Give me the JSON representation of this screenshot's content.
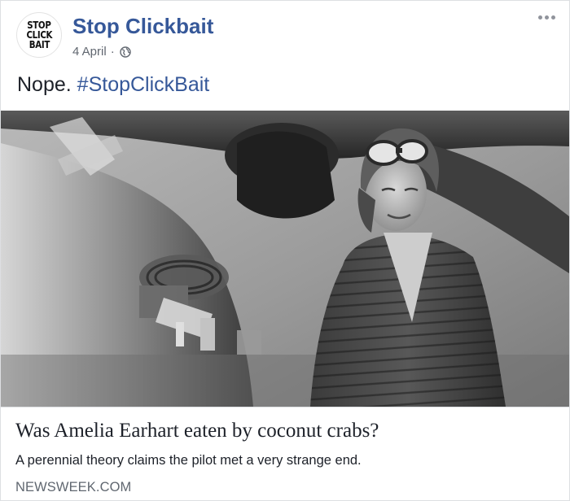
{
  "post": {
    "page_name": "Stop Clickbait",
    "avatar_lines": [
      "STOP",
      "CLICK",
      "BAIT"
    ],
    "date": "4 April",
    "separator": "·",
    "audience_icon": "globe-icon",
    "menu_icon": "more-options-icon",
    "text_prefix": "Nope. ",
    "hashtag": "#StopClickBait"
  },
  "link_preview": {
    "image_description_icon": "photo-thumbnail",
    "title": "Was Amelia Earhart eaten by coconut crabs?",
    "description": "A perennial theory claims the pilot met a very strange end.",
    "source": "NEWSWEEK.COM"
  },
  "colors": {
    "link_blue": "#365899",
    "text": "#1d2129",
    "meta_gray": "#616770",
    "border": "#dddfe2"
  }
}
